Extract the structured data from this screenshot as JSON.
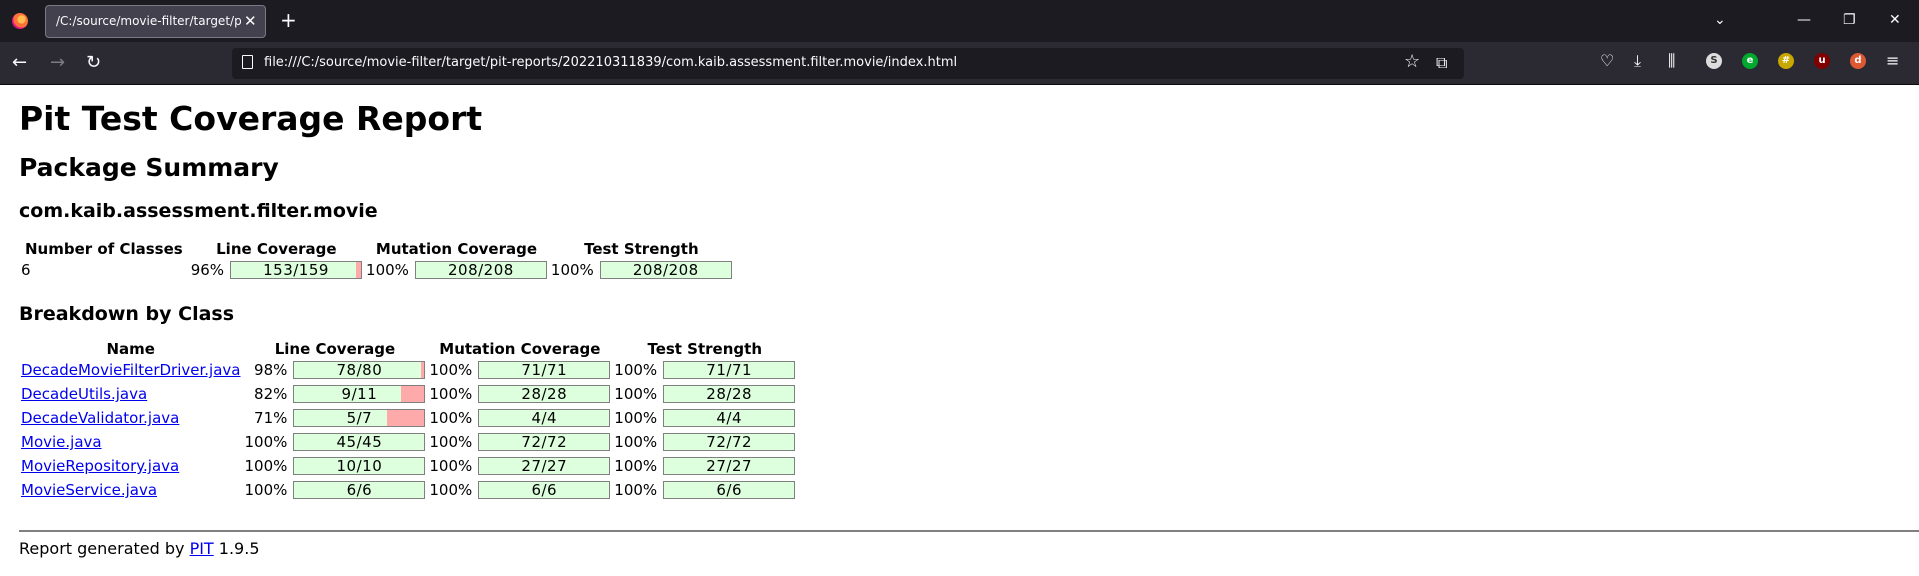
{
  "browser": {
    "tab_title": "/C:/source/movie-filter/target/pit-r",
    "url": "file:///C:/source/movie-filter/target/pit-reports/202210311839/com.kaib.assessment.filter.movie/index.html"
  },
  "report": {
    "title": "Pit Test Coverage Report",
    "subtitle": "Package Summary",
    "package_name": "com.kaib.assessment.filter.movie",
    "summary": {
      "headers": [
        "Number of Classes",
        "Line Coverage",
        "Mutation Coverage",
        "Test Strength"
      ],
      "classes": "6",
      "line": {
        "pct": "96%",
        "text": "153/159",
        "fraction": 0.962
      },
      "mutation": {
        "pct": "100%",
        "text": "208/208",
        "fraction": 1.0
      },
      "strength": {
        "pct": "100%",
        "text": "208/208",
        "fraction": 1.0
      }
    },
    "breakdown_title": "Breakdown by Class",
    "breakdown_headers": [
      "Name",
      "Line Coverage",
      "Mutation Coverage",
      "Test Strength"
    ],
    "rows": [
      {
        "name": "DecadeMovieFilterDriver.java",
        "line_pct": "98%",
        "line_text": "78/80",
        "line_frac": 0.975,
        "mut_pct": "100%",
        "mut_text": "71/71",
        "str_pct": "100%",
        "str_text": "71/71"
      },
      {
        "name": "DecadeUtils.java",
        "line_pct": "82%",
        "line_text": "9/11",
        "line_frac": 0.818,
        "mut_pct": "100%",
        "mut_text": "28/28",
        "str_pct": "100%",
        "str_text": "28/28"
      },
      {
        "name": "DecadeValidator.java",
        "line_pct": "71%",
        "line_text": "5/7",
        "line_frac": 0.714,
        "mut_pct": "100%",
        "mut_text": "4/4",
        "str_pct": "100%",
        "str_text": "4/4"
      },
      {
        "name": "Movie.java",
        "line_pct": "100%",
        "line_text": "45/45",
        "line_frac": 1.0,
        "mut_pct": "100%",
        "mut_text": "72/72",
        "str_pct": "100%",
        "str_text": "72/72"
      },
      {
        "name": "MovieRepository.java",
        "line_pct": "100%",
        "line_text": "10/10",
        "line_frac": 1.0,
        "mut_pct": "100%",
        "mut_text": "27/27",
        "str_pct": "100%",
        "str_text": "27/27"
      },
      {
        "name": "MovieService.java",
        "line_pct": "100%",
        "line_text": "6/6",
        "line_frac": 1.0,
        "mut_pct": "100%",
        "mut_text": "6/6",
        "str_pct": "100%",
        "str_text": "6/6"
      }
    ],
    "footer_prefix": "Report generated by ",
    "footer_link": "PIT",
    "footer_version": " 1.9.5"
  },
  "colors": {
    "covered": "#ddffdd",
    "missed": "#ffaaaa"
  }
}
